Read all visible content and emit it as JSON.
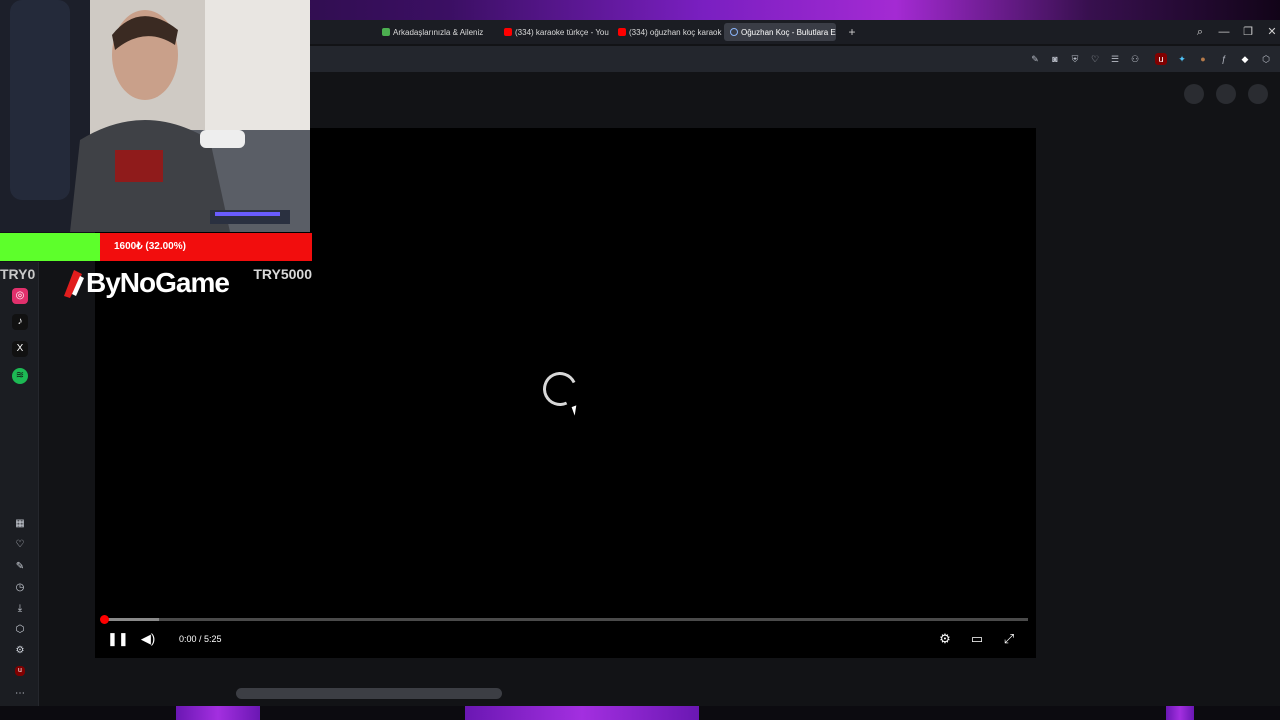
{
  "browser": {
    "tabs": [
      {
        "label": "Arkadaşlarınızla & Aileniz",
        "favicon_color": "#4caf50"
      },
      {
        "label": "(334) karaoke türkçe - You",
        "favicon_color": "#ff0000"
      },
      {
        "label": "(334) oğuzhan koç karaok",
        "favicon_color": "#ff0000"
      },
      {
        "label": "Oğuzhan Koç - Bulutlara E",
        "favicon_color": "#8ab4f8",
        "active": true
      }
    ],
    "new_tab_symbol": "+",
    "window_controls": {
      "search": "⌕",
      "minimize": "—",
      "restore": "❐",
      "close": "✕"
    }
  },
  "toolbar": {
    "icons": [
      "edit-icon",
      "camera-icon",
      "shield-icon",
      "heart-icon",
      "menu-icon",
      "profile-icon",
      "ublock-icon",
      "pen-icon",
      "extension-icon",
      "diamond-icon",
      "cube-icon"
    ]
  },
  "sidebar": {
    "items": [
      {
        "icon": "instagram-icon",
        "glyph": "◎",
        "color": "#e1306c"
      },
      {
        "icon": "tiktok-icon",
        "glyph": "♪",
        "color": "#111111"
      },
      {
        "icon": "x-icon",
        "glyph": "X",
        "color": "#111111"
      },
      {
        "icon": "spotify-icon",
        "glyph": "≋",
        "color": "#1db954"
      },
      {
        "icon": "grid-icon",
        "glyph": "▦",
        "color": "transparent"
      },
      {
        "icon": "heart-icon",
        "glyph": "♡",
        "color": "transparent"
      },
      {
        "icon": "pin-icon",
        "glyph": "✎",
        "color": "transparent"
      },
      {
        "icon": "history-icon",
        "glyph": "◷",
        "color": "transparent"
      },
      {
        "icon": "download-icon",
        "glyph": "⤓",
        "color": "transparent"
      },
      {
        "icon": "box-icon",
        "glyph": "⬡",
        "color": "transparent"
      },
      {
        "icon": "settings-icon",
        "glyph": "⚙",
        "color": "transparent"
      },
      {
        "icon": "ublock-icon",
        "glyph": "u",
        "color": "#800000"
      },
      {
        "icon": "more-icon",
        "glyph": "⋯",
        "color": "transparent"
      }
    ]
  },
  "video": {
    "time_display": "0:00 / 5:25",
    "progress_fraction": 0.0,
    "buffered_fraction": 0.06,
    "state": "loading"
  },
  "overlay": {
    "donation_text": "1600₺ (32.00%)",
    "donation_fraction": 0.32,
    "promo_left": "TRY0",
    "promo_brand": "ByNoGame",
    "promo_code": "TRY5000"
  },
  "colors": {
    "accent": "#ff0000",
    "donation_green": "#5dff2b",
    "donation_red": "#f20d0d"
  }
}
